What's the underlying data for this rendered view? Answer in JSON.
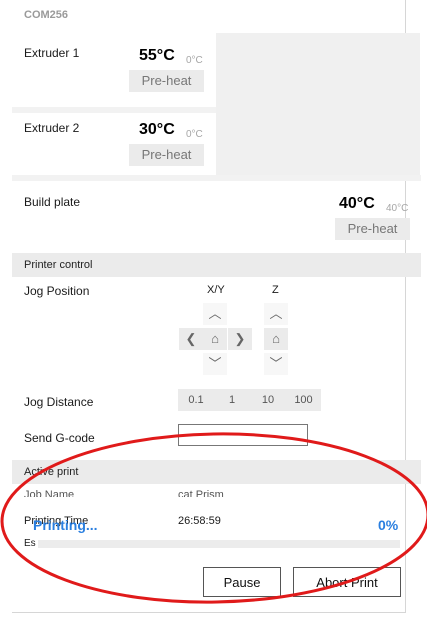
{
  "connection": {
    "name": "COM256"
  },
  "extruders": [
    {
      "label": "Extruder 1",
      "temperature": "55°C",
      "target": "0°C",
      "preheat_label": "Pre-heat"
    },
    {
      "label": "Extruder 2",
      "temperature": "30°C",
      "target": "0°C",
      "preheat_label": "Pre-heat"
    }
  ],
  "build_plate": {
    "label": "Build plate",
    "temperature": "40°C",
    "target": "40°C",
    "preheat_label": "Pre-heat"
  },
  "printer_control": {
    "header": "Printer control",
    "jog_position_label": "Jog Position",
    "xy_label": "X/Y",
    "z_label": "Z",
    "jog_distance_label": "Jog Distance",
    "jog_distances": [
      "0.1",
      "1",
      "10",
      "100"
    ],
    "send_gcode_label": "Send G-code",
    "gcode_value": ""
  },
  "active_print": {
    "header": "Active print",
    "job_name_label": "Job Name",
    "job_name_value": "cat Prism",
    "printing_time_label": "Printing Time",
    "printing_time_value": "26:58:59",
    "estimated_label": "Es",
    "status": "Printing...",
    "progress_text": "0%",
    "progress": 0,
    "pause_label": "Pause",
    "abort_label": "Abort Print"
  },
  "colors": {
    "status_blue": "#2a7fe0",
    "annotation_red": "#e01a1a"
  },
  "icons": [
    "chevron-up-icon",
    "chevron-down-icon",
    "chevron-left-icon",
    "chevron-right-icon",
    "home-icon"
  ]
}
